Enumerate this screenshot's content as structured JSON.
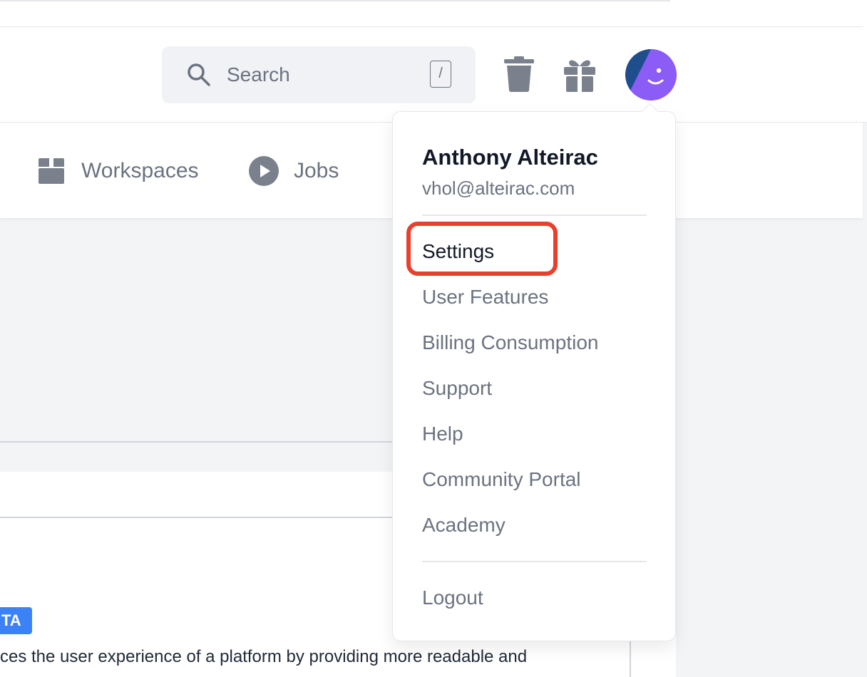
{
  "header": {
    "search": {
      "placeholder": "Search",
      "shortcut": "/"
    },
    "icons": [
      "trash-icon",
      "gift-icon",
      "user-avatar"
    ]
  },
  "nav": {
    "items": [
      {
        "label": "Workspaces",
        "icon": "box-icon"
      },
      {
        "label": "Jobs",
        "icon": "play-icon"
      }
    ]
  },
  "background": {
    "badge": "TA",
    "description": "ces the user experience of a platform by providing more readable and"
  },
  "user_menu": {
    "name": "Anthony Alteirac",
    "email": "vhol@alteirac.com",
    "items": [
      {
        "label": "Settings",
        "highlighted": true
      },
      {
        "label": "User Features"
      },
      {
        "label": "Billing Consumption"
      },
      {
        "label": "Support"
      },
      {
        "label": "Help"
      },
      {
        "label": "Community Portal"
      },
      {
        "label": "Academy"
      }
    ],
    "logout": "Logout"
  },
  "colors": {
    "highlight": "#e8402d",
    "avatar_primary": "#8b5cf6",
    "avatar_secondary": "#1e4e8c",
    "badge": "#3b82f6",
    "icon_gray": "#7b818c"
  }
}
